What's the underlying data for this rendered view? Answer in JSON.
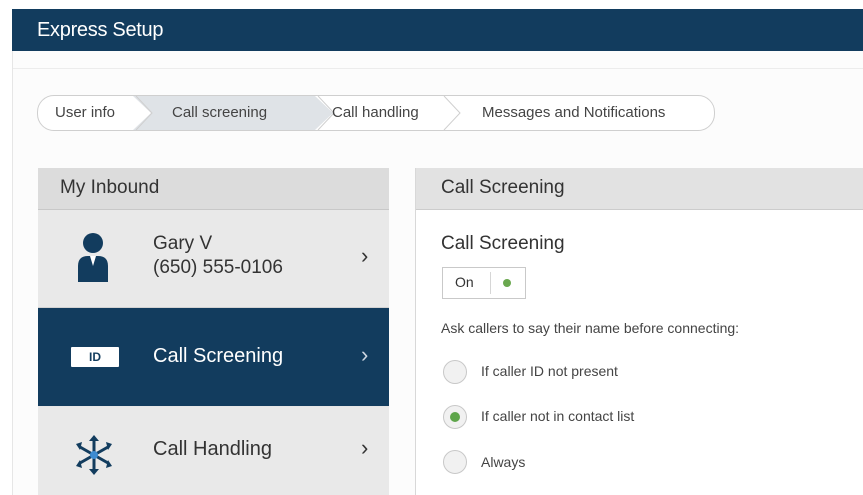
{
  "app": {
    "title": "Express Setup"
  },
  "breadcrumb": {
    "steps": [
      "User info",
      "Call screening",
      "Call handling",
      "Messages and Notifications"
    ],
    "active_index": 1
  },
  "inbound": {
    "title": "My Inbound",
    "user": {
      "name": "Gary V",
      "phone": "(650) 555-0106"
    },
    "items": [
      {
        "label": "Call Screening",
        "icon": "id-badge-icon",
        "icon_text": "ID"
      },
      {
        "label": "Call Handling",
        "icon": "call-handling-icon"
      }
    ],
    "chevron": "›"
  },
  "panel": {
    "title": "Call Screening",
    "section_title": "Call Screening",
    "toggle_label": "On",
    "prompt": "Ask callers to say their name before connecting:",
    "options": [
      {
        "label": "If caller ID not present",
        "selected": false
      },
      {
        "label": "If caller not in contact list",
        "selected": true
      },
      {
        "label": "Always",
        "selected": false
      }
    ]
  },
  "colors": {
    "header_navy": "#123c5e",
    "selected_green": "#5ea54a",
    "panel_grey": "#e6e6e6"
  }
}
